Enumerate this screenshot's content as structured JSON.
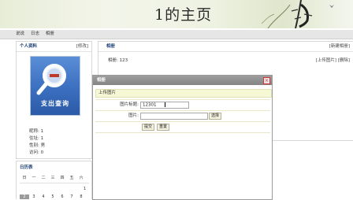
{
  "banner": {
    "title": "1的主页"
  },
  "nav": {
    "items": [
      "说说",
      "日志",
      "相册"
    ]
  },
  "profile": {
    "header": "个人资料",
    "edit_label": "[修改]",
    "avatar_caption": "支出查询",
    "fields": [
      {
        "label": "昵称",
        "value": "1"
      },
      {
        "label": "住址",
        "value": "1"
      },
      {
        "label": "性别",
        "value": "男"
      },
      {
        "label": "访问",
        "value": "0"
      }
    ]
  },
  "calendar": {
    "title": "日历表",
    "weekdays": [
      "日",
      "一",
      "二",
      "三",
      "四",
      "五",
      "六"
    ],
    "first_day": "1",
    "days": [
      "2",
      "3",
      "4",
      "5",
      "6",
      "7",
      "8"
    ]
  },
  "album": {
    "header": "相册",
    "new_label": "[新建相册]",
    "photo_label": "相册:",
    "photo_value": "123",
    "actions": "[上传图片] [删除]"
  },
  "dialog": {
    "title": "相册",
    "close_label": "×",
    "section_title": "上传图片",
    "title_field_label": "图片标题:",
    "title_field_value": "12301",
    "image_field_label": "图片:",
    "browse_label": "选择",
    "submit_label": "提交",
    "reset_label": "重置"
  },
  "colors": {
    "dialog_title_bg": "#8e8e8e",
    "section_bg": "#f6f7d4",
    "link_blue": "#1a3f74"
  }
}
